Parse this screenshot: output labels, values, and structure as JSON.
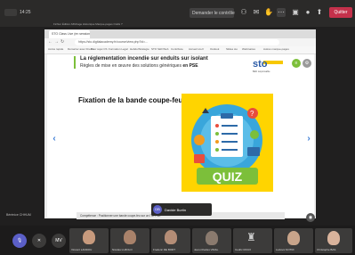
{
  "topbar": {
    "menu_items": "Fichier  Édition  Affichage  Historique  Marque-pages  Outils  ?",
    "share_request": "Demander le contrôle",
    "quit": "Quitter"
  },
  "browser": {
    "tab_label": "STO Class Live (en session)",
    "url": "https://sto.digitalacademy.fr/course/view.php?id=...",
    "bookmarks": [
      "Accès rapide",
      "Démarrer avec Firefox",
      "Pour sujet CS",
      "Formation Legal",
      "Hebdo/Stratégie",
      "STO Skill Web",
      "Contribute",
      "Accueil sto.fr",
      "Outlook",
      "Slides sto",
      "Webinaires",
      "Autres marque-pages"
    ]
  },
  "slide": {
    "title": "La réglementation incendie sur enduits sur isolant",
    "subtitle_prefix": "Règles de mise en œuvre des solutions génériques ",
    "subtitle_bold": "en PSE",
    "logo": "sto",
    "logo_sub": "Bâtir responsable",
    "heading": "Fixation de la  bande coupe-feu",
    "quiz_label": "QUIZ",
    "competences": "Compétence : Positionner une bande coupe-feu sur un ITE PSE",
    "prev_arrow": "‹",
    "next_arrow": "›"
  },
  "presenter": {
    "initials": "DB",
    "name": "Davide Burtin"
  },
  "sender_label": "Bérénice CHHUM",
  "controls": {
    "mic_icon": "mic-icon",
    "close_icon": "close-icon",
    "my_initials": "MV"
  },
  "participants": [
    {
      "name": "Vincent LANDOU"
    },
    {
      "name": "Nicolas LUZOLO"
    },
    {
      "name": "Frederic DE BORT"
    },
    {
      "name": "Jean-Charles VIDAL"
    },
    {
      "name": "Cedric ROUX"
    },
    {
      "name": "Ludovic NOTRI"
    },
    {
      "name": "Christophe BAS"
    }
  ],
  "colors": {
    "accent": "#5b5fc7",
    "quit_red": "#c4314b",
    "quiz_yellow": "#ffd400",
    "sto_blue": "#2a5aa6"
  }
}
